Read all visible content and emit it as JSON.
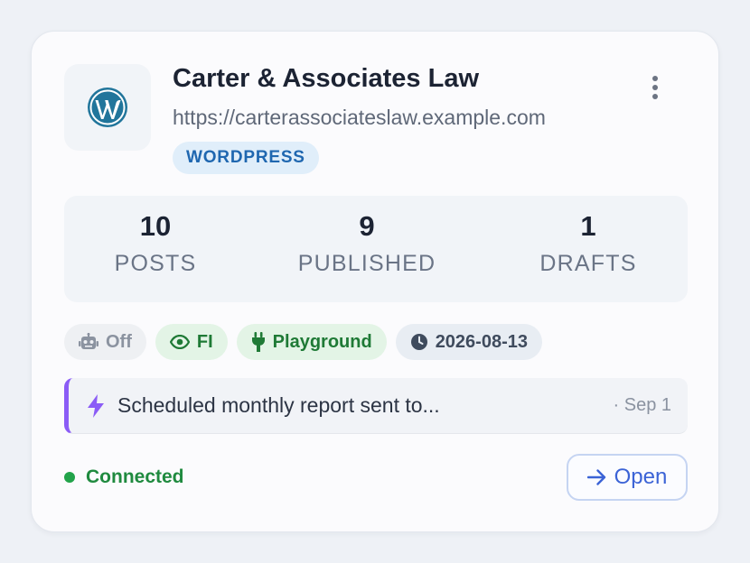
{
  "site": {
    "name": "Carter & Associates Law",
    "url": "https://carterassociateslaw.example.com",
    "platform_badge": "WORDPRESS"
  },
  "stats": [
    {
      "value": "10",
      "label": "POSTS"
    },
    {
      "value": "9",
      "label": "PUBLISHED"
    },
    {
      "value": "1",
      "label": "DRAFTS"
    }
  ],
  "chips": {
    "ai": {
      "label": "Off",
      "icon": "robot-icon"
    },
    "fi": {
      "label": "FI",
      "icon": "eye-icon"
    },
    "playground": {
      "label": "Playground",
      "icon": "plug-icon"
    },
    "date": {
      "label": "2026-08-13",
      "icon": "clock-icon"
    }
  },
  "activity": {
    "text": "Scheduled monthly report sent to...",
    "date": "· Sep 1",
    "icon": "lightning-icon"
  },
  "status": {
    "label": "Connected"
  },
  "actions": {
    "open_label": "Open"
  },
  "colors": {
    "accent": "#3b63d6",
    "badge_bg": "#e0eefa",
    "badge_text": "#1f67b0",
    "success": "#22a34a",
    "activity_border": "#8b5cf6",
    "wordpress_blue": "#21759b"
  }
}
